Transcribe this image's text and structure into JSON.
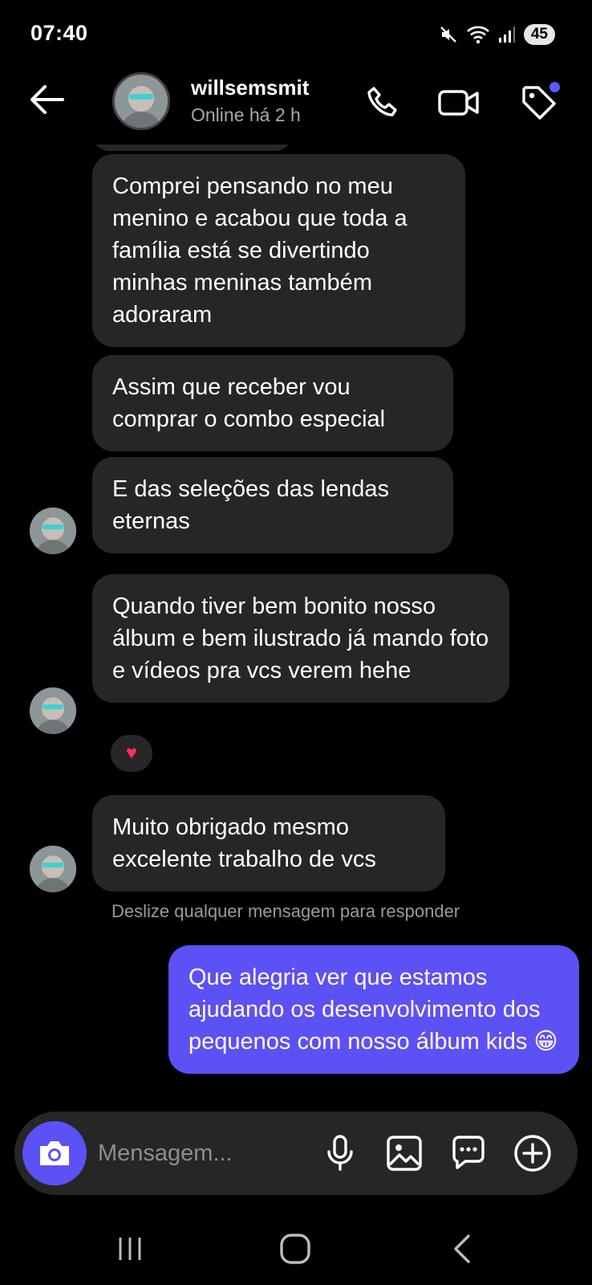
{
  "status_bar": {
    "time": "07:40",
    "battery": "45"
  },
  "header": {
    "username": "willsemsmit",
    "presence": "Online há 2 h"
  },
  "messages": [
    {
      "from": "them",
      "text": "Comprei pensando no meu menino e acabou que toda a família está se divertindo minhas meninas também adoraram"
    },
    {
      "from": "them",
      "text": "Assim que receber vou comprar o combo especial"
    },
    {
      "from": "them",
      "text": "E das seleções das lendas eternas"
    },
    {
      "from": "them",
      "text": "Quando tiver bem bonito nosso álbum e bem ilustrado já mando foto e vídeos pra vcs verem hehe",
      "reaction": "♥"
    },
    {
      "from": "them",
      "text": "Muito obrigado mesmo excelente trabalho de vcs"
    },
    {
      "from": "me",
      "text": "Que alegria ver que estamos ajudando os desenvolvimento dos pequenos com nosso álbum kids 😁"
    }
  ],
  "hint": "Deslize qualquer mensagem para responder",
  "composer": {
    "placeholder": "Mensagem..."
  },
  "colors": {
    "accent": "#5b51f5",
    "bubble_other": "#262626",
    "background": "#000000"
  },
  "icons": {
    "header": [
      "back-arrow-icon",
      "phone-icon",
      "video-camera-icon",
      "tag-icon"
    ],
    "composer": [
      "camera-icon",
      "microphone-icon",
      "image-icon",
      "sticker-icon",
      "plus-circle-icon"
    ],
    "navigation": [
      "recent-apps-icon",
      "home-icon",
      "back-nav-icon"
    ]
  }
}
